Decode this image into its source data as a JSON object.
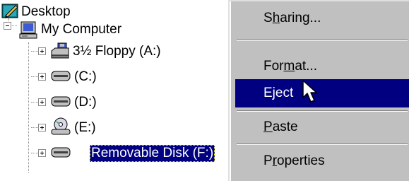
{
  "tree": {
    "items": [
      {
        "label": "Desktop",
        "icon": "desktop-icon"
      },
      {
        "label": "My Computer",
        "icon": "computer-icon"
      },
      {
        "label": "3½ Floppy (A:)",
        "icon": "floppy-drive-icon"
      },
      {
        "label": "(C:)",
        "icon": "hard-drive-icon"
      },
      {
        "label": "(D:)",
        "icon": "hard-drive-icon"
      },
      {
        "label": "(E:)",
        "icon": "cd-drive-icon"
      },
      {
        "label": "Removable Disk (F:)",
        "icon": "removable-disk-icon",
        "selected": true
      }
    ]
  },
  "menu": {
    "items": [
      {
        "pre": "S",
        "acc": "h",
        "post": "aring..."
      },
      {
        "pre": "For",
        "acc": "m",
        "post": "at..."
      },
      {
        "pre": "",
        "acc": "",
        "post": "Eject",
        "highlighted": true
      },
      {
        "pre": "",
        "acc": "P",
        "post": "aste"
      },
      {
        "pre": "P",
        "acc": "r",
        "post": "operties"
      }
    ]
  },
  "colors": {
    "selection": "#000080",
    "menu_bg": "#c0c0c0"
  }
}
